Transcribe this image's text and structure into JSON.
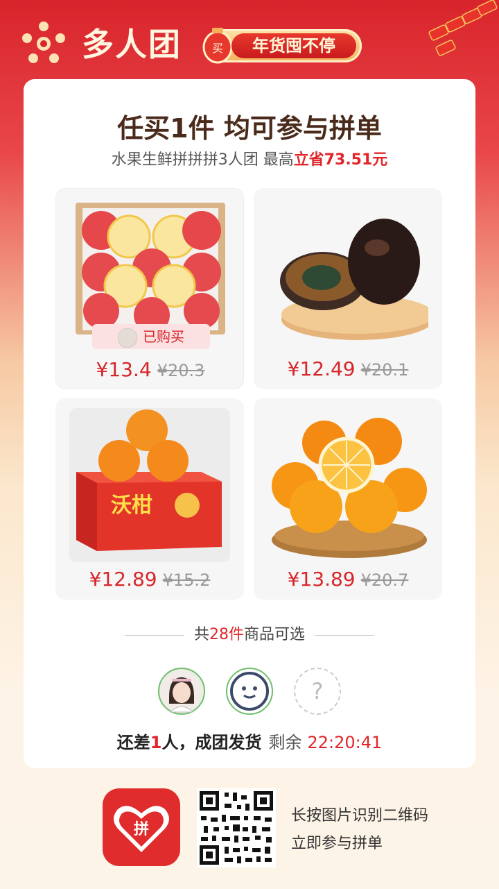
{
  "header": {
    "brand": "多人团",
    "promo_badge": "买",
    "promo_text": "年货囤不停"
  },
  "card": {
    "title": "任买1件 均可参与拼单",
    "subtitle_prefix": "水果生鲜拼拼拼3人团 最高",
    "subtitle_highlight": "立省73.51元"
  },
  "products": [
    {
      "name": "apple-box",
      "price": "¥13.4",
      "old_price": "¥20.3",
      "badge": "已购买"
    },
    {
      "name": "preserved-egg",
      "price": "¥12.49",
      "old_price": "¥20.1"
    },
    {
      "name": "mandarin-box",
      "price": "¥12.89",
      "old_price": "¥15.2",
      "box_label": "沃柑"
    },
    {
      "name": "orange-basket",
      "price": "¥13.89",
      "old_price": "¥20.7"
    }
  ],
  "count": {
    "prefix": "共",
    "number": "28件",
    "suffix": "商品可选"
  },
  "status": {
    "prefix": "还差",
    "count": "1",
    "suffix": "人，成团发货",
    "remaining_label": "剩余",
    "time": "22:20:41"
  },
  "avatars": {
    "empty_mark": "?"
  },
  "footer": {
    "app_label": "拼",
    "line1": "长按图片识别二维码",
    "line2": "立即参与拼单"
  },
  "colors": {
    "accent": "#e0262a",
    "brand_red": "#d8242b",
    "card_bg": "#ffffff"
  }
}
